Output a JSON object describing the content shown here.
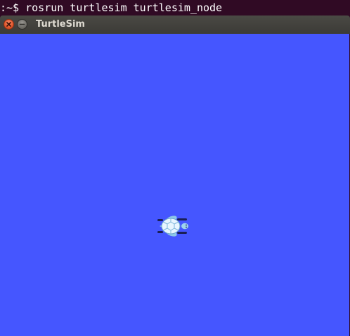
{
  "terminal": {
    "command_line": ":~$ rosrun turtlesim turtlesim_node"
  },
  "window": {
    "title": "TurtleSim",
    "buttons": {
      "close_icon": "close-icon",
      "minimize_icon": "minimize-icon"
    }
  },
  "canvas": {
    "background_color": "#4556ff"
  },
  "turtle": {
    "icon": "turtle-icon",
    "heading": "east"
  }
}
